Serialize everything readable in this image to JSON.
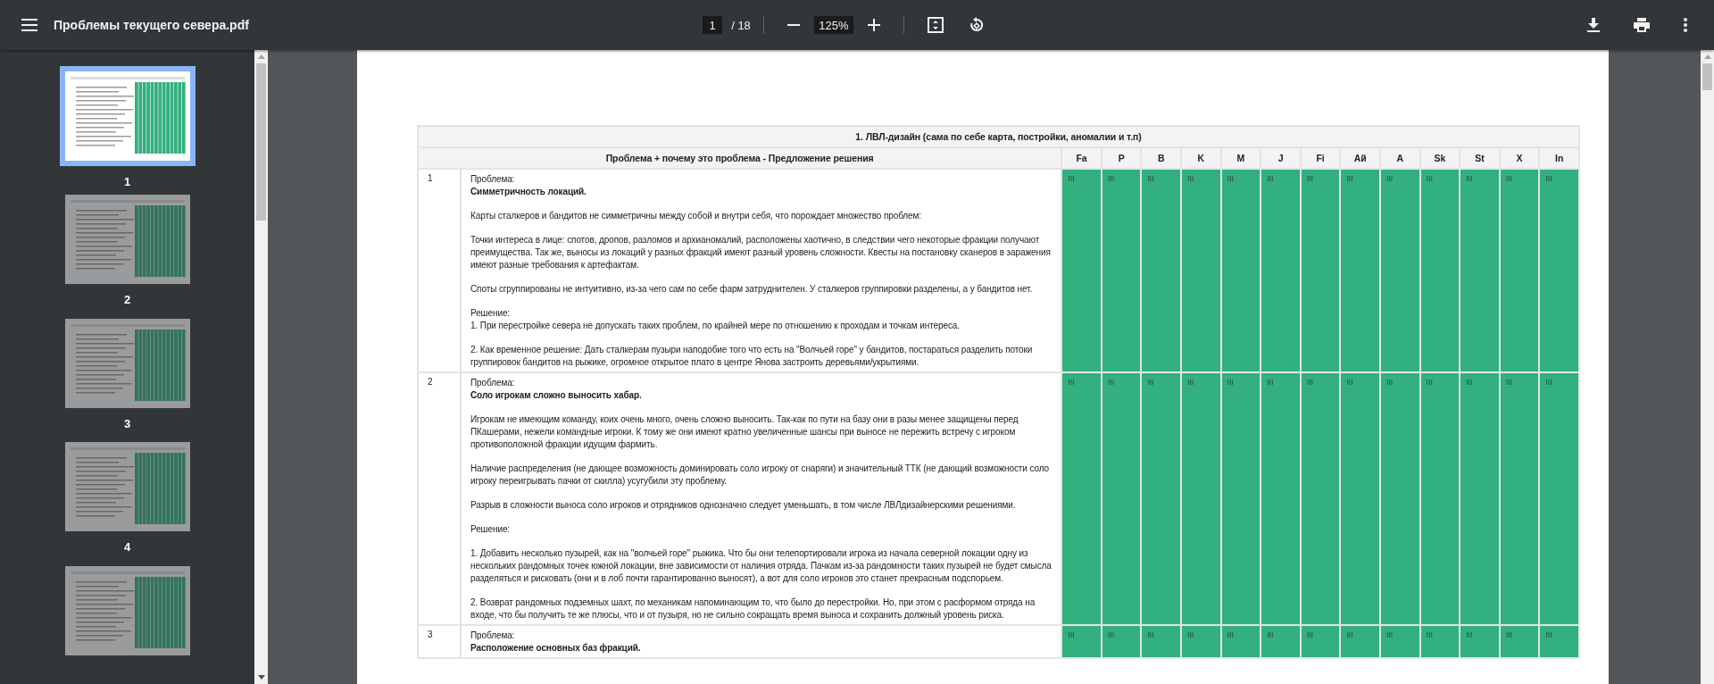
{
  "toolbar": {
    "title": "Проблемы текущего севера.pdf",
    "page_input": "1",
    "page_total": "/ 18",
    "zoom": "125%"
  },
  "pages": [
    {
      "label": "1",
      "selected": true
    },
    {
      "label": "2",
      "selected": false
    },
    {
      "label": "3",
      "selected": false
    },
    {
      "label": "4",
      "selected": false
    },
    {
      "selected": false
    }
  ],
  "table": {
    "title": "1. ЛВЛ-дизайн (сама по себе карта, постройки, аномалии и т.п)",
    "problem_header": "Проблема + почему это проблема - Предложение решения",
    "columns": [
      "Fa",
      "P",
      "B",
      "K",
      "M",
      "J",
      "Fi",
      "Ай",
      "A",
      "Sk",
      "St",
      "X",
      "In"
    ],
    "rows": [
      {
        "number": "1",
        "label": "Проблема:",
        "title": "Симметричность локаций.",
        "blocks": [
          [
            "Карты сталкеров и бандитов не симметричны между собой и внутри себя, что порождает множество проблем:"
          ],
          [
            "Точки интереса в лице: спотов, дропов, разломов и архианомалий, расположены хаотично, в следствии чего некоторые фракции получают преимущества. Так же, выносы из локаций у разных фракций имеют разный уровень сложности. Квесты на постановку сканеров в заражения имеют разные требования к артефактам."
          ],
          [
            "Споты сгруппированы не интуитивно, из-за чего сам по себе фарм затруднителен. У сталкеров группировки разделены, а у бандитов нет."
          ],
          [
            "Решение:",
            "1. При перестройке севера не допускать таких проблем, по крайней мере по отношению к проходам и точкам интереса."
          ],
          [
            "2. Как временное решение: Дать сталкерам пузыри наподобие того что есть на \"Волчьей горе\" у бандитов, постараться разделить потоки группировок бандитов на рыжике, огромное открытое плато в центре Янова застроить деревьями/укрытиями."
          ]
        ],
        "scores": [
          {
            "text": "III",
            "color": "#33b07f"
          },
          {
            "text": "III",
            "color": "#33b07f"
          },
          {
            "text": "III",
            "color": "#33b07f"
          },
          {
            "text": "III",
            "color": "#33b07f"
          },
          {
            "text": "III",
            "color": "#33b07f"
          },
          {
            "text": "III",
            "color": "#33b07f"
          },
          {
            "text": "III",
            "color": "#33b07f"
          },
          {
            "text": "III",
            "color": "#33b07f"
          },
          {
            "text": "III",
            "color": "#33b07f"
          },
          {
            "text": "III",
            "color": "#33b07f"
          },
          {
            "text": "III",
            "color": "#33b07f"
          },
          {
            "text": "III",
            "color": "#33b07f"
          },
          {
            "text": "III",
            "color": "#33b07f"
          }
        ]
      },
      {
        "number": "2",
        "label": "Проблема:",
        "title": "Соло игрокам сложно выносить хабар.",
        "blocks": [
          [
            "Игрокам не имеющим команду, коих очень много, очень сложно выносить. Так-как по пути на базу они в разы менее защищены перед ПКашерами, нежели командные игроки. К тому же они имеют кратно увеличенные шансы при выносе не пережить встречу с игроком противоположной фракции идущим фармить."
          ],
          [
            "Наличие распределения (не дающее возможность доминировать соло игроку от снаряги) и значительный ТТК (не дающий возможности соло игроку переигрывать пачки от скилла) усугубили эту проблему."
          ],
          [
            "Разрыв в сложности выноса соло игроков и отрядников однозначно следует уменьшать, в том числе ЛВЛдизайнерскими решениями."
          ],
          [
            "Решение:"
          ],
          [
            "1. Добавить несколько пузырей, как на \"волчьей горе\" рыжика. Что бы они телепортировали игрока из начала северной локации одну из нескольких рандомных точек южной локации, вне зависимости от наличия отряда. Пачкам из-за рандомности таких пузырей не будет смысла разделяться и рисковать (они и в лоб почти гарантированно выносят), а вот для соло игроков это станет прекрасным подспорьем."
          ],
          [
            "2. Возврат рандомных подземных шахт, по механикам напоминающим то, что было до перестройки. Но, при этом с расформом отряда на входе, что бы получить те же плюсы, что и от пузыря, но не сильно сокращать время выноса и сохранить должный уровень риска."
          ]
        ],
        "scores": [
          {
            "text": "III",
            "color": "#33b07f"
          },
          {
            "text": "III",
            "color": "#33b07f"
          },
          {
            "text": "III",
            "color": "#33b07f"
          },
          {
            "text": "III",
            "color": "#33b07f"
          },
          {
            "text": "III",
            "color": "#33b07f"
          },
          {
            "text": "III",
            "color": "#33b07f"
          },
          {
            "text": "III",
            "color": "#33b07f"
          },
          {
            "text": "III",
            "color": "#33b07f"
          },
          {
            "text": "III",
            "color": "#33b07f"
          },
          {
            "text": "III",
            "color": "#33b07f"
          },
          {
            "text": "III",
            "color": "#33b07f"
          },
          {
            "text": "III",
            "color": "#33b07f"
          },
          {
            "text": "III",
            "color": "#33b07f"
          }
        ]
      },
      {
        "number": "3",
        "label": "Проблема:",
        "title": "Расположение основных баз фракций.",
        "scores": [
          {
            "text": "III",
            "color": "#33b07f"
          },
          {
            "text": "III",
            "color": "#33b07f"
          },
          {
            "text": "III",
            "color": "#33b07f"
          },
          {
            "text": "III",
            "color": "#33b07f"
          },
          {
            "text": "III",
            "color": "#33b07f"
          },
          {
            "text": "III",
            "color": "#33b07f"
          },
          {
            "text": "III",
            "color": "#33b07f"
          },
          {
            "text": "III",
            "color": "#33b07f"
          },
          {
            "text": "III",
            "color": "#33b07f"
          },
          {
            "text": "III",
            "color": "#33b07f"
          },
          {
            "text": "III",
            "color": "#33b07f"
          },
          {
            "text": "III",
            "color": "#33b07f"
          },
          {
            "text": "III",
            "color": "#33b07f"
          }
        ]
      }
    ]
  }
}
